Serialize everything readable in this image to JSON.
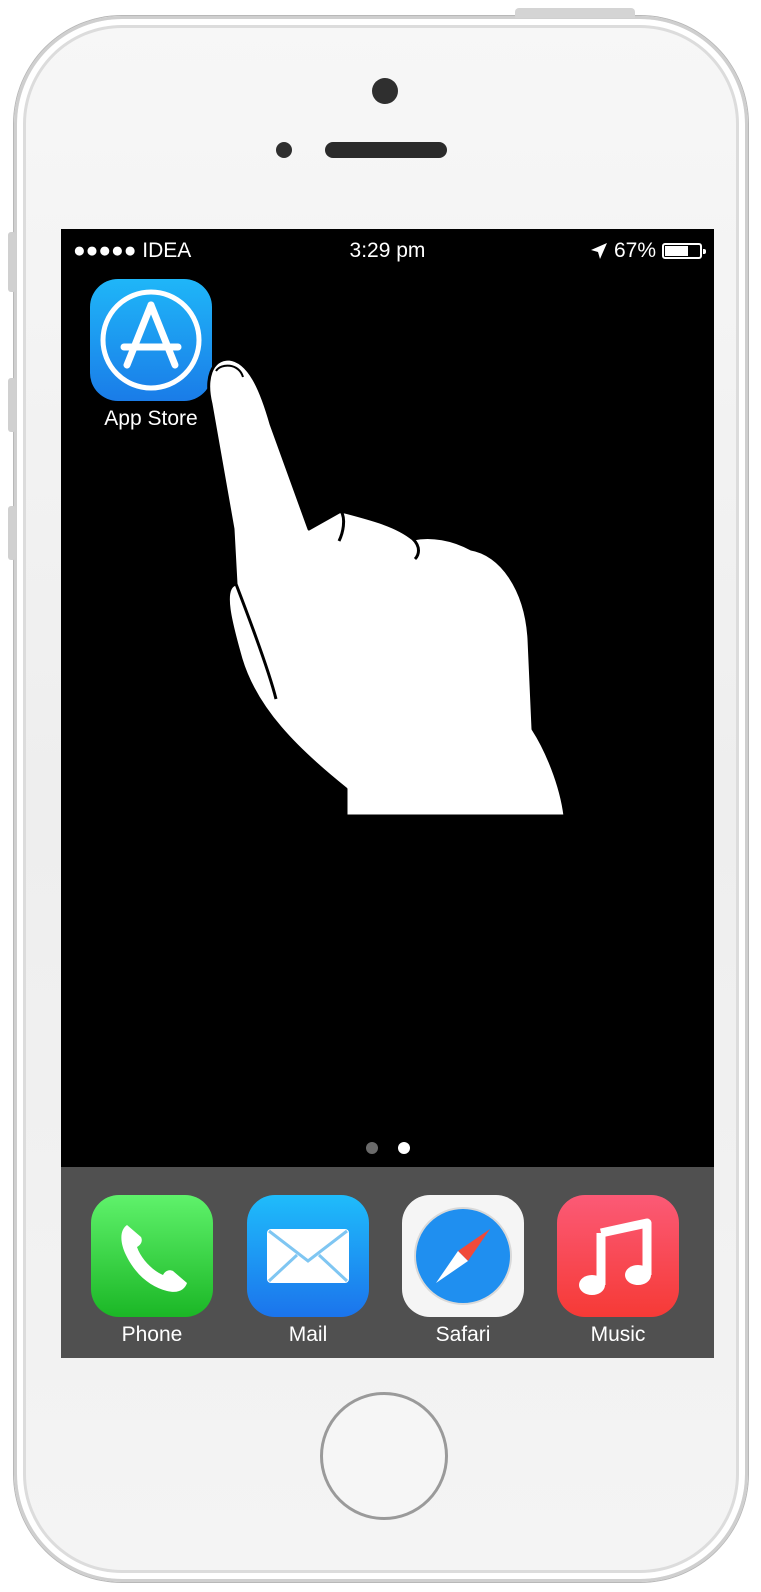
{
  "status_bar": {
    "carrier": "●●●●● IDEA",
    "time": "3:29 pm",
    "battery": "67%",
    "battery_level": 0.67,
    "location_icon": "location-arrow-icon"
  },
  "home_screen": {
    "apps": [
      {
        "label": "App Store",
        "icon": "app-store-icon"
      }
    ],
    "page_dots": {
      "count": 2,
      "active_index": 1
    },
    "gesture": "hand-tap-icon"
  },
  "dock": {
    "apps": [
      {
        "label": "Phone",
        "icon": "phone-icon"
      },
      {
        "label": "Mail",
        "icon": "mail-icon"
      },
      {
        "label": "Safari",
        "icon": "safari-icon"
      },
      {
        "label": "Music",
        "icon": "music-icon"
      }
    ]
  },
  "colors": {
    "screen_background": "#000000",
    "dock_background": "#505050",
    "phone_body": "#f2f2f2"
  }
}
